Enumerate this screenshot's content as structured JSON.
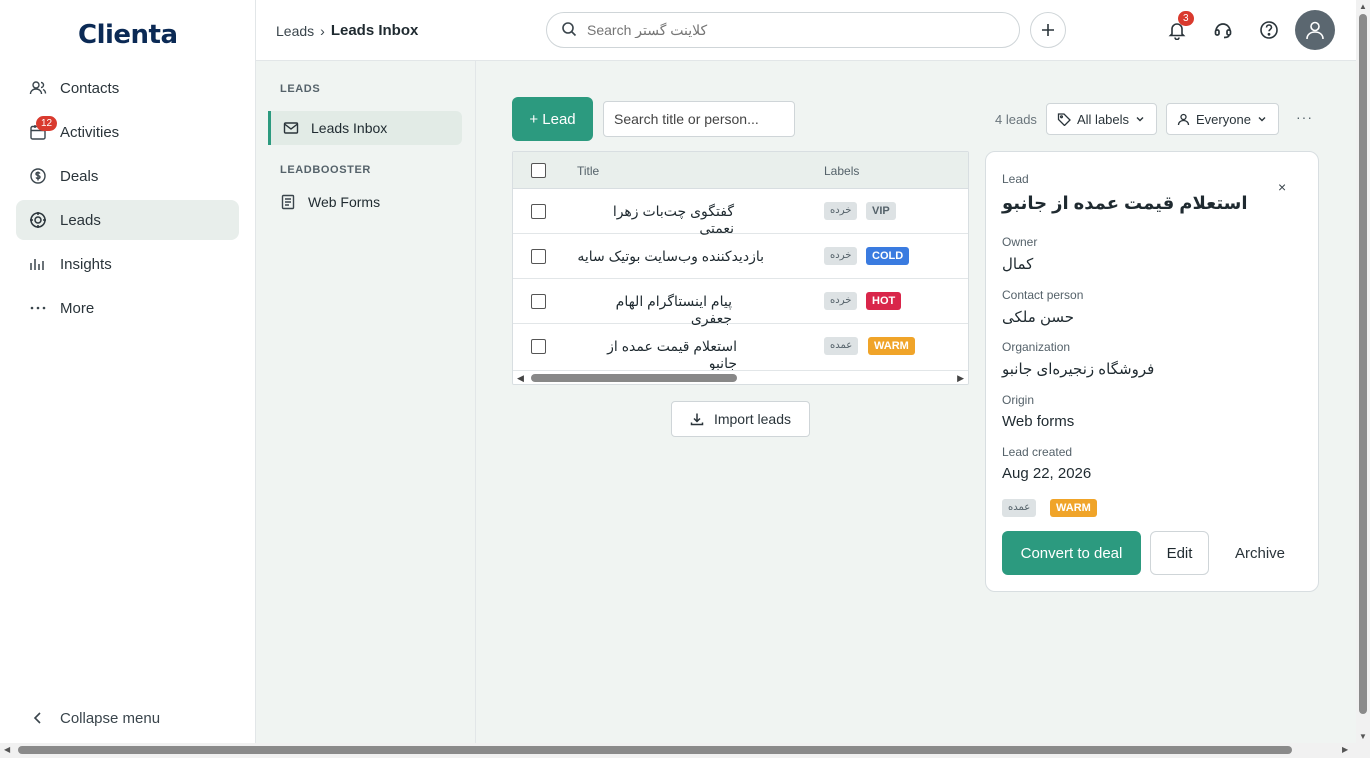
{
  "app": {
    "logo": "Clienta"
  },
  "nav": {
    "items": [
      {
        "label": "Contacts",
        "icon": "contacts-icon"
      },
      {
        "label": "Activities",
        "icon": "calendar-icon",
        "badge": "12"
      },
      {
        "label": "Deals",
        "icon": "dollar-icon"
      },
      {
        "label": "Leads",
        "icon": "target-icon",
        "active": true
      },
      {
        "label": "Insights",
        "icon": "bar-chart-icon"
      },
      {
        "label": "More",
        "icon": "more-icon"
      }
    ],
    "collapse_label": "Collapse menu"
  },
  "header": {
    "breadcrumb_parent": "Leads",
    "breadcrumb_sep": "›",
    "breadcrumb_current": "Leads Inbox",
    "search_placeholder": "Search کلاینت گستر",
    "notification_badge": "3"
  },
  "subnav": {
    "section_leads": "LEADS",
    "item_inbox": "Leads Inbox",
    "section_booster": "LEADBOOSTER",
    "item_forms": "Web Forms"
  },
  "toolbar": {
    "add_lead": "+ Lead",
    "search_placeholder": "Search title or person...",
    "count": "4 leads",
    "labels_filter": "All labels",
    "owner_filter": "Everyone",
    "more": "···"
  },
  "table": {
    "col_title": "Title",
    "col_labels": "Labels",
    "rows": [
      {
        "title": "گفتگوی چت‌بات زهرا نعمتی",
        "tag1": "خرده",
        "tag2": "VIP",
        "tag2_color": "#dde2e4",
        "tag2_text": "#55626a"
      },
      {
        "title": "بازدیدکننده وب‌سایت بوتیک سایه",
        "tag1": "خرده",
        "tag2": "COLD",
        "tag2_color": "#3a7be0",
        "tag2_text": "#ffffff"
      },
      {
        "title": "پیام اینستاگرام الهام جعفری",
        "tag1": "خرده",
        "tag2": "HOT",
        "tag2_color": "#d9264a",
        "tag2_text": "#ffffff"
      },
      {
        "title": "استعلام قیمت عمده از جانبو",
        "tag1": "عمده",
        "tag2": "WARM",
        "tag2_color": "#f0a429",
        "tag2_text": "#ffffff"
      }
    ],
    "import_label": "Import leads"
  },
  "panel": {
    "kicker": "Lead",
    "title": "استعلام قیمت عمده از جانبو",
    "owner_label": "Owner",
    "owner": "کمال",
    "contact_label": "Contact person",
    "contact": "حسن ملکی",
    "org_label": "Organization",
    "org": "فروشگاه زنجیره‌ای جانبو",
    "origin_label": "Origin",
    "origin": "Web forms",
    "created_label": "Lead created",
    "created": "Aug 22, 2026",
    "tag1": "عمده",
    "tag2": "WARM",
    "convert": "Convert to deal",
    "edit": "Edit",
    "archive": "Archive",
    "close": "×"
  },
  "colors": {
    "accent": "#2c9a7f",
    "warm": "#f0a429",
    "cold": "#3a7be0",
    "hot": "#d9264a",
    "alert": "#d93a2e"
  }
}
